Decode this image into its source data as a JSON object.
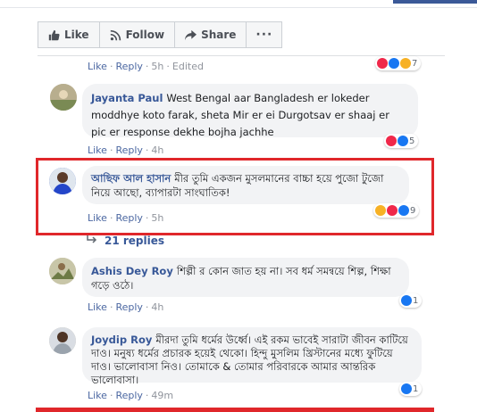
{
  "actions": {
    "like": "Like",
    "follow": "Follow",
    "share": "Share",
    "more": "···"
  },
  "top_meta": {
    "like": "Like",
    "reply": "Reply",
    "time": "5h",
    "edited": "Edited",
    "sep": "·",
    "count": "7"
  },
  "comments": [
    {
      "author": "Jayanta Paul",
      "text": "West Bengal aar Bangladesh er lokeder moddhye koto farak, sheta Mir er ei Durgotsav er shaaj er pic er response dekhe bojha jachhe",
      "like": "Like",
      "reply": "Reply",
      "time": "4h",
      "reaction_count": "5"
    },
    {
      "author": "আছিফ আল হাসান",
      "text": "মীর তুমি একজন মুসলমানের বাচ্চা হয়ে পুজো টুজো নিয়ে আছো, ব্যাপারটা সাংঘাতিক!",
      "like": "Like",
      "reply": "Reply",
      "time": "5h",
      "reaction_count": "9"
    },
    {
      "author": "Ashis Dey Roy",
      "text": "শিল্পী র কোন জাত হয় না। সব ধর্ম সমন্বয়ে শিল্প, শিক্ষা গড়ে ওঠে।",
      "like": "Like",
      "reply": "Reply",
      "time": "4h",
      "reaction_count": "1"
    },
    {
      "author": "Joydip Roy",
      "text": "মীরদা তুমি ধর্মের উর্ধ্বে। এই রকম ভাবেই সারাটা জীবন কাটিয়ে দাও। মনুষ্য ধর্মের প্রচারক হয়েই থেকো। হিন্দু মুসলিম খ্রিস্টানের মধ্যে ফুটিয়ে দাও। ভালোবাসা নিও। তোমাকে & তোমার পরিবারকে আমার আন্তরিক ভালোবাসা।",
      "like": "Like",
      "reply": "Reply",
      "time": "49m",
      "reaction_count": "1"
    }
  ],
  "replies_label": "21 replies",
  "colors": {
    "link": "#385898",
    "highlight": "#e0272b",
    "bubble": "#f2f3f5"
  }
}
